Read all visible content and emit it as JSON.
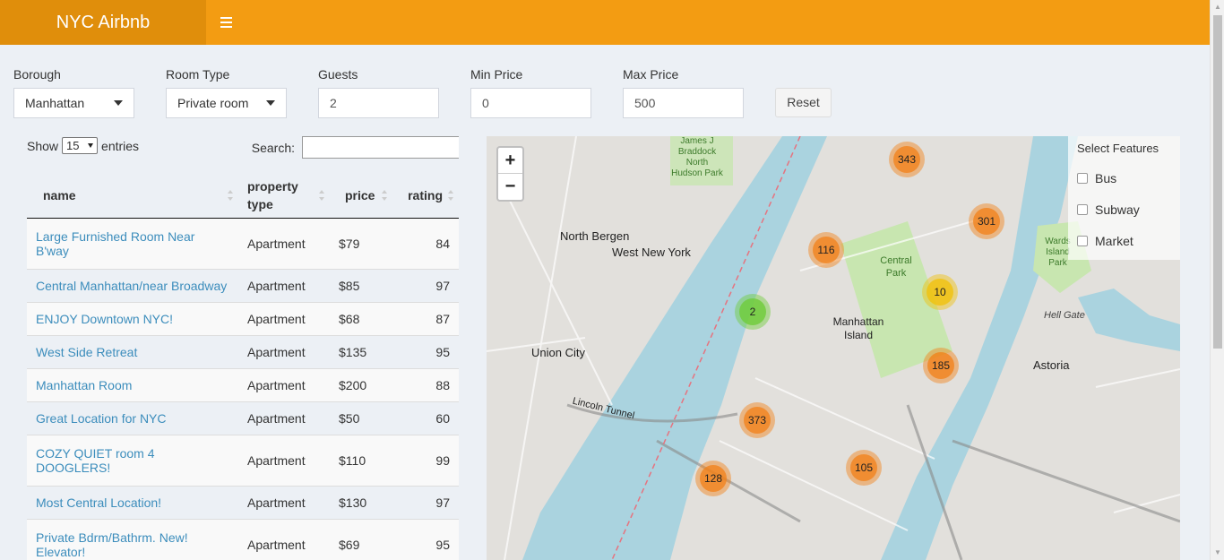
{
  "app": {
    "title": "NYC Airbnb",
    "menu_icon": "hamburger-icon"
  },
  "filters": {
    "borough": {
      "label": "Borough",
      "value": "Manhattan"
    },
    "room_type": {
      "label": "Room Type",
      "value": "Private room"
    },
    "guests": {
      "label": "Guests",
      "value": "2"
    },
    "min_price": {
      "label": "Min Price",
      "value": "0"
    },
    "max_price": {
      "label": "Max Price",
      "value": "500"
    },
    "reset_label": "Reset"
  },
  "table": {
    "show_label": "Show",
    "entries_value": "15",
    "entries_label": "entries",
    "search_label": "Search:",
    "search_value": "",
    "columns": [
      "name",
      "property type",
      "price",
      "rating"
    ],
    "rows": [
      {
        "name": "Large Furnished Room Near B'way",
        "type": "Apartment",
        "price": "$79",
        "rating": "84"
      },
      {
        "name": "Central Manhattan/near Broadway",
        "type": "Apartment",
        "price": "$85",
        "rating": "97"
      },
      {
        "name": "ENJOY Downtown NYC!",
        "type": "Apartment",
        "price": "$68",
        "rating": "87"
      },
      {
        "name": "West Side Retreat",
        "type": "Apartment",
        "price": "$135",
        "rating": "95"
      },
      {
        "name": "Manhattan Room",
        "type": "Apartment",
        "price": "$200",
        "rating": "88"
      },
      {
        "name": "Great Location for NYC",
        "type": "Apartment",
        "price": "$50",
        "rating": "60"
      },
      {
        "name": "COZY QUIET room 4 DOOGLERS!",
        "type": "Apartment",
        "price": "$110",
        "rating": "99"
      },
      {
        "name": "Most Central Location!",
        "type": "Apartment",
        "price": "$130",
        "rating": "97"
      },
      {
        "name": "Private Bdrm/Bathrm. New! Elevator!",
        "type": "Apartment",
        "price": "$69",
        "rating": "95"
      }
    ]
  },
  "map": {
    "zoom_in": "+",
    "zoom_out": "−",
    "features_title": "Select Features",
    "features": [
      "Bus",
      "Subway",
      "Market"
    ],
    "clusters": [
      "343",
      "301",
      "116",
      "10",
      "2",
      "185",
      "373",
      "105",
      "128"
    ],
    "labels": [
      "North Bergen",
      "West New York",
      "Union City",
      "Manhattan Island",
      "Central Park",
      "Astoria",
      "Hell Gate",
      "James J Braddock North Hudson Park",
      "Wards Island Park",
      "Lincoln Tunnel"
    ]
  }
}
